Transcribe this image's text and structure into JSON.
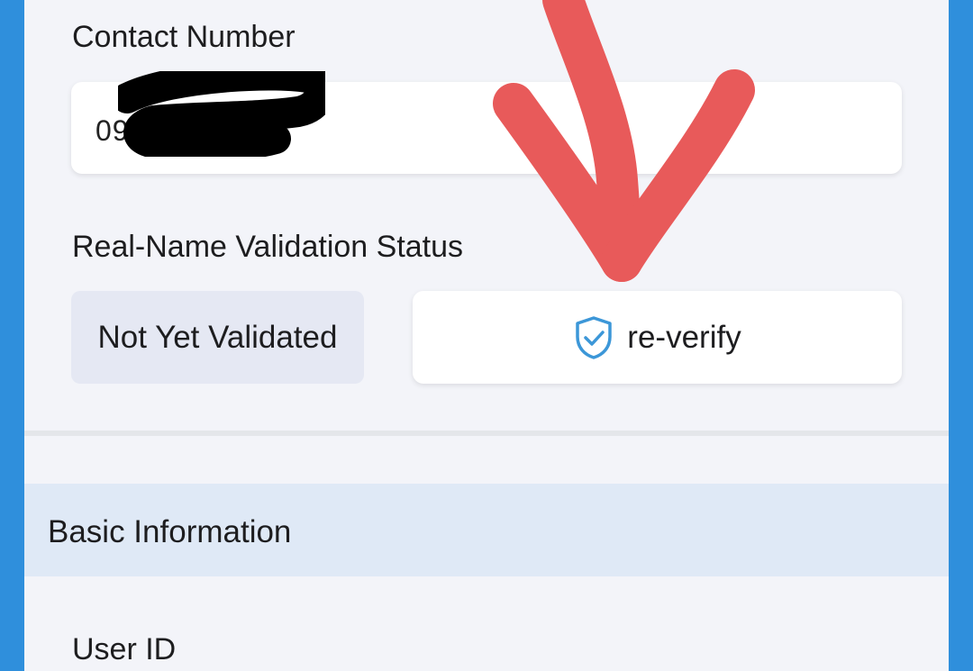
{
  "contact": {
    "label": "Contact Number",
    "value": "09          72"
  },
  "validation": {
    "label": "Real-Name Validation Status",
    "status": "Not Yet Validated",
    "reverify_label": "re-verify",
    "reverify_icon": "shield-check-icon"
  },
  "basic_info": {
    "header": "Basic Information",
    "user_id_label": "User ID"
  },
  "colors": {
    "frame_blue": "#2f8fdc",
    "background": "#f3f4f9",
    "chip_bg": "#e5e8f3",
    "section_header_bg": "#dfe9f6",
    "shield_blue": "#3c97d8",
    "annotation_red": "#e85a5a"
  }
}
